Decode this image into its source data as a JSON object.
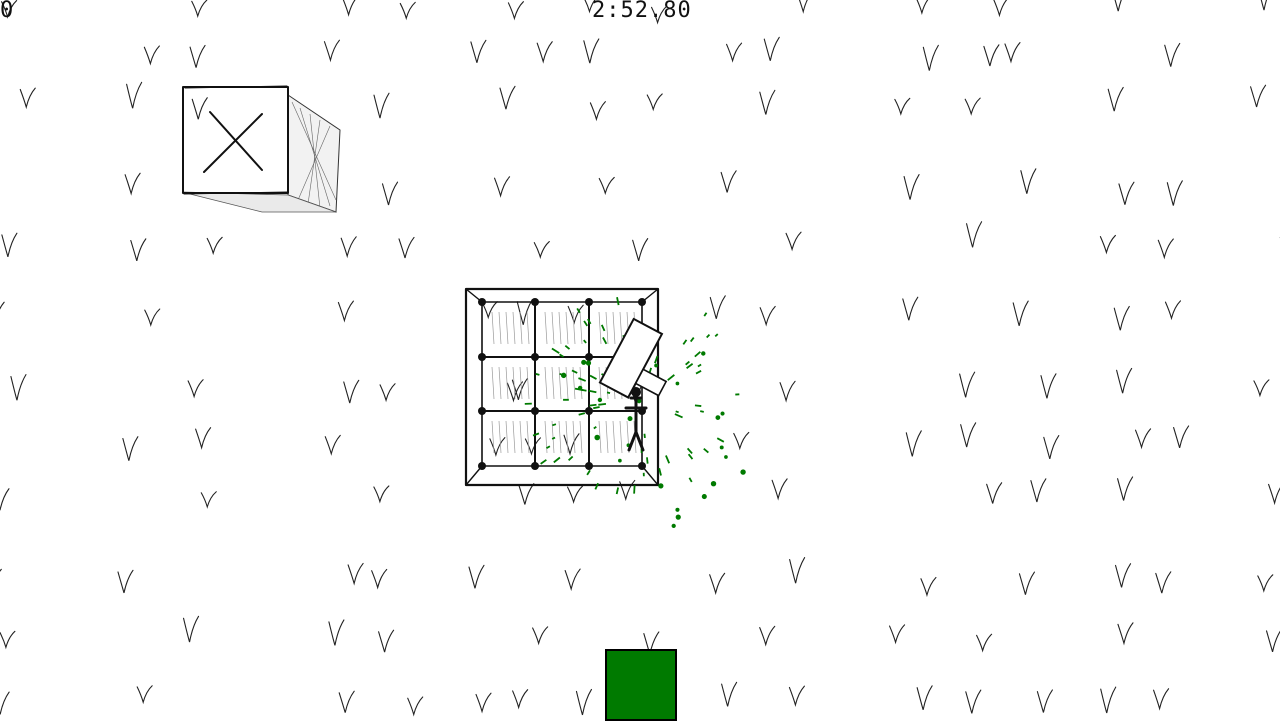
{
  "hud": {
    "score": "0",
    "timer": "2:52.80"
  },
  "colors": {
    "accent": "#007a00",
    "ink": "#111111",
    "paper": "#ffffff"
  },
  "icons": {
    "crate": "x-crate-icon",
    "platform": "grid-platform",
    "player": "stick-figure-with-cannon",
    "action": "green-square-button"
  }
}
